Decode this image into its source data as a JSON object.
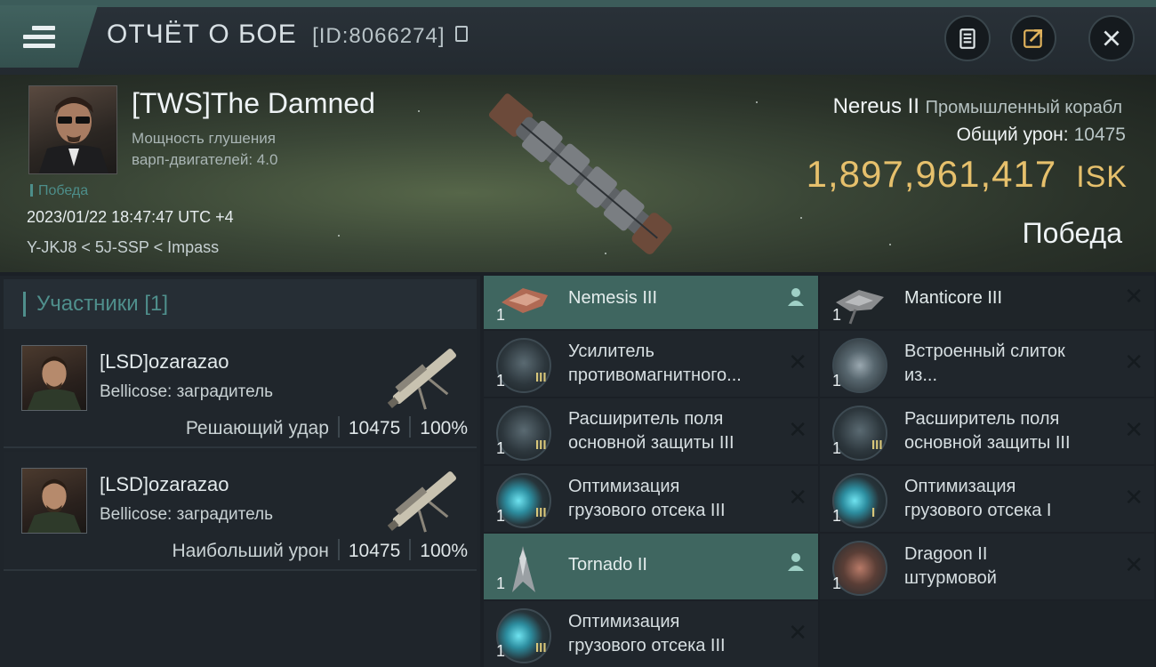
{
  "header": {
    "title": "ОТЧЁТ О БОЕ",
    "report_id": "[ID:8066274]",
    "buttons": [
      "clipboard-icon",
      "share-icon",
      "close-icon"
    ]
  },
  "victim": {
    "name": "[TWS]The Damned",
    "attribute_line1": "Мощность глушения",
    "attribute_line2": "варп-двигателей: 4.0",
    "result_small": "Победа",
    "datetime": "2023/01/22 18:47:47 UTC +4",
    "location": "Y-JKJ8 < 5J-SSP < Impass",
    "ship_name": "Nereus II",
    "ship_class": "Промышленный корабл",
    "total_damage_label": "Общий урон:",
    "total_damage_value": "10475",
    "isk_value": "1,897,961,417",
    "isk_currency": "ISK",
    "result_big": "Победа"
  },
  "participants": {
    "title": "Участники [1]",
    "attackers": [
      {
        "name": "[LSD]ozarazao",
        "ship": "Bellicose: заградитель",
        "role": "Решающий удар",
        "damage": "10475",
        "percent": "100%"
      },
      {
        "name": "[LSD]ozarazao",
        "ship": "Bellicose: заградитель",
        "role": "Наибольший урон",
        "damage": "10475",
        "percent": "100%"
      }
    ]
  },
  "items_left": [
    {
      "qty": "1",
      "label_line1": "Nemesis III",
      "label_line2": "",
      "level": "",
      "kind": "ship"
    },
    {
      "qty": "1",
      "label_line1": "Усилитель",
      "label_line2": "противомагнитного...",
      "level": "III",
      "kind": "module"
    },
    {
      "qty": "1",
      "label_line1": "Расширитель поля",
      "label_line2": "основной защиты III",
      "level": "III",
      "kind": "module"
    },
    {
      "qty": "1",
      "label_line1": "Оптимизация",
      "label_line2": "грузового отсека III",
      "level": "III",
      "kind": "rig"
    },
    {
      "qty": "1",
      "label_line1": "Tornado II",
      "label_line2": "",
      "level": "",
      "kind": "ship"
    },
    {
      "qty": "1",
      "label_line1": "Оптимизация",
      "label_line2": "грузового отсека III",
      "level": "III",
      "kind": "rig"
    }
  ],
  "items_right": [
    {
      "qty": "1",
      "label_line1": "Manticore III",
      "label_line2": "",
      "level": "",
      "kind": "ship-plain"
    },
    {
      "qty": "1",
      "label_line1": "Встроенный слиток",
      "label_line2": "из...",
      "level": "",
      "kind": "ingot"
    },
    {
      "qty": "1",
      "label_line1": "Расширитель поля",
      "label_line2": "основной защиты III",
      "level": "III",
      "kind": "module"
    },
    {
      "qty": "1",
      "label_line1": "Оптимизация",
      "label_line2": "грузового отсека I",
      "level": "I",
      "kind": "rig"
    },
    {
      "qty": "1",
      "label_line1": "Dragoon II",
      "label_line2": "штурмовой",
      "level": "",
      "kind": "drone"
    }
  ],
  "icons": {
    "close_mark": "✕",
    "person": "person-icon"
  },
  "colors": {
    "accent_teal": "#4f8f8c",
    "isk_gold": "#e6c06c",
    "highlight_row": "#3f6660"
  }
}
